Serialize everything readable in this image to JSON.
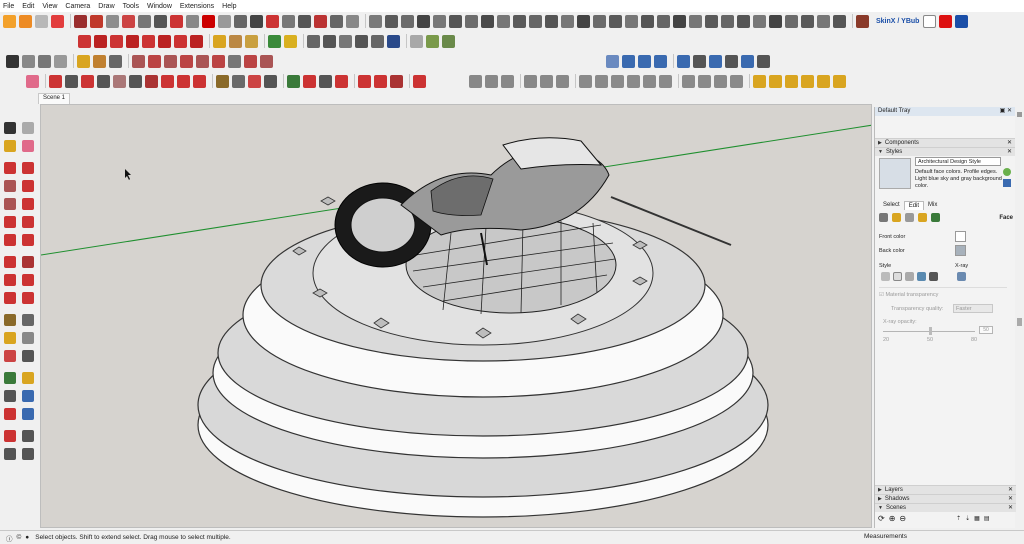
{
  "menu": [
    "File",
    "Edit",
    "View",
    "Camera",
    "Draw",
    "Tools",
    "Window",
    "Extensions",
    "Help"
  ],
  "plugin_badge": "SkinX / YBub",
  "scene_tab": "Scene 1",
  "tray": {
    "title": "Default Tray",
    "panels_top": [
      "Components",
      "Styles"
    ],
    "style_name": "Architectural Design Style",
    "style_description": "Default face colors. Profile edges. Light blue sky and gray background color.",
    "tabs": [
      "Select",
      "Edit",
      "Mix"
    ],
    "face_label": "Face",
    "front_color_label": "Front color",
    "back_color_label": "Back color",
    "style_label": "Style",
    "xray_label": "X-ray",
    "material_transparency_label": "Material transparency",
    "transparency_quality_label": "Transparency quality:",
    "transparency_quality_value": "Faster",
    "xray_opacity_label": "X-ray opacity:",
    "opacity_ticks": [
      "20",
      "50",
      "80"
    ],
    "opacity_value": "50",
    "panels_bottom": [
      "Layers",
      "Shadows",
      "Scenes"
    ]
  },
  "colors": {
    "front_color": "#ffffff",
    "back_color": "#a7b1bb",
    "viewport_bg": "#d6d3cf",
    "axis_green": "#1f8f2f"
  },
  "status": {
    "text": "Select objects. Shift to extend select. Drag mouse to select multiple.",
    "measurements_label": "Measurements"
  }
}
